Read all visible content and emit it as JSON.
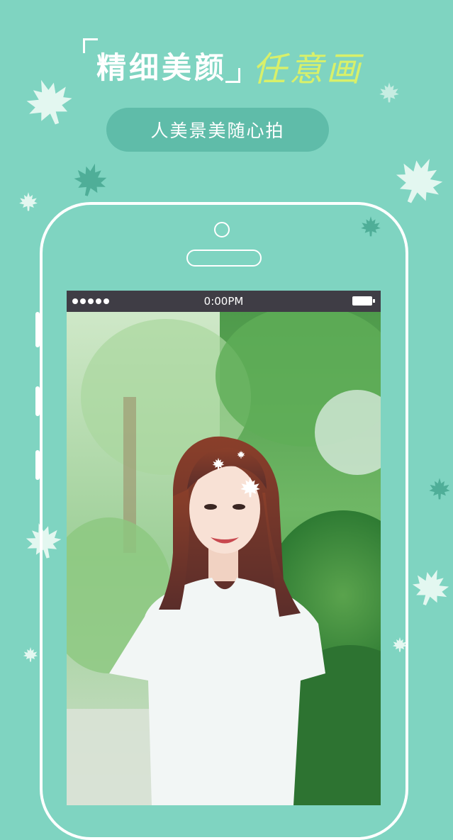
{
  "headline": {
    "main": "精细美颜",
    "accent": "任意画"
  },
  "subtitle": "人美景美随心拍",
  "statusbar": {
    "time": "0:00PM"
  },
  "colors": {
    "background": "#7fd4c1",
    "accent_text": "#d8f06a",
    "pill": "#5fbca9",
    "statusbar": "#3f3d45"
  },
  "icons": [
    "maple-leaf-icon",
    "battery-icon",
    "signal-dots-icon"
  ]
}
